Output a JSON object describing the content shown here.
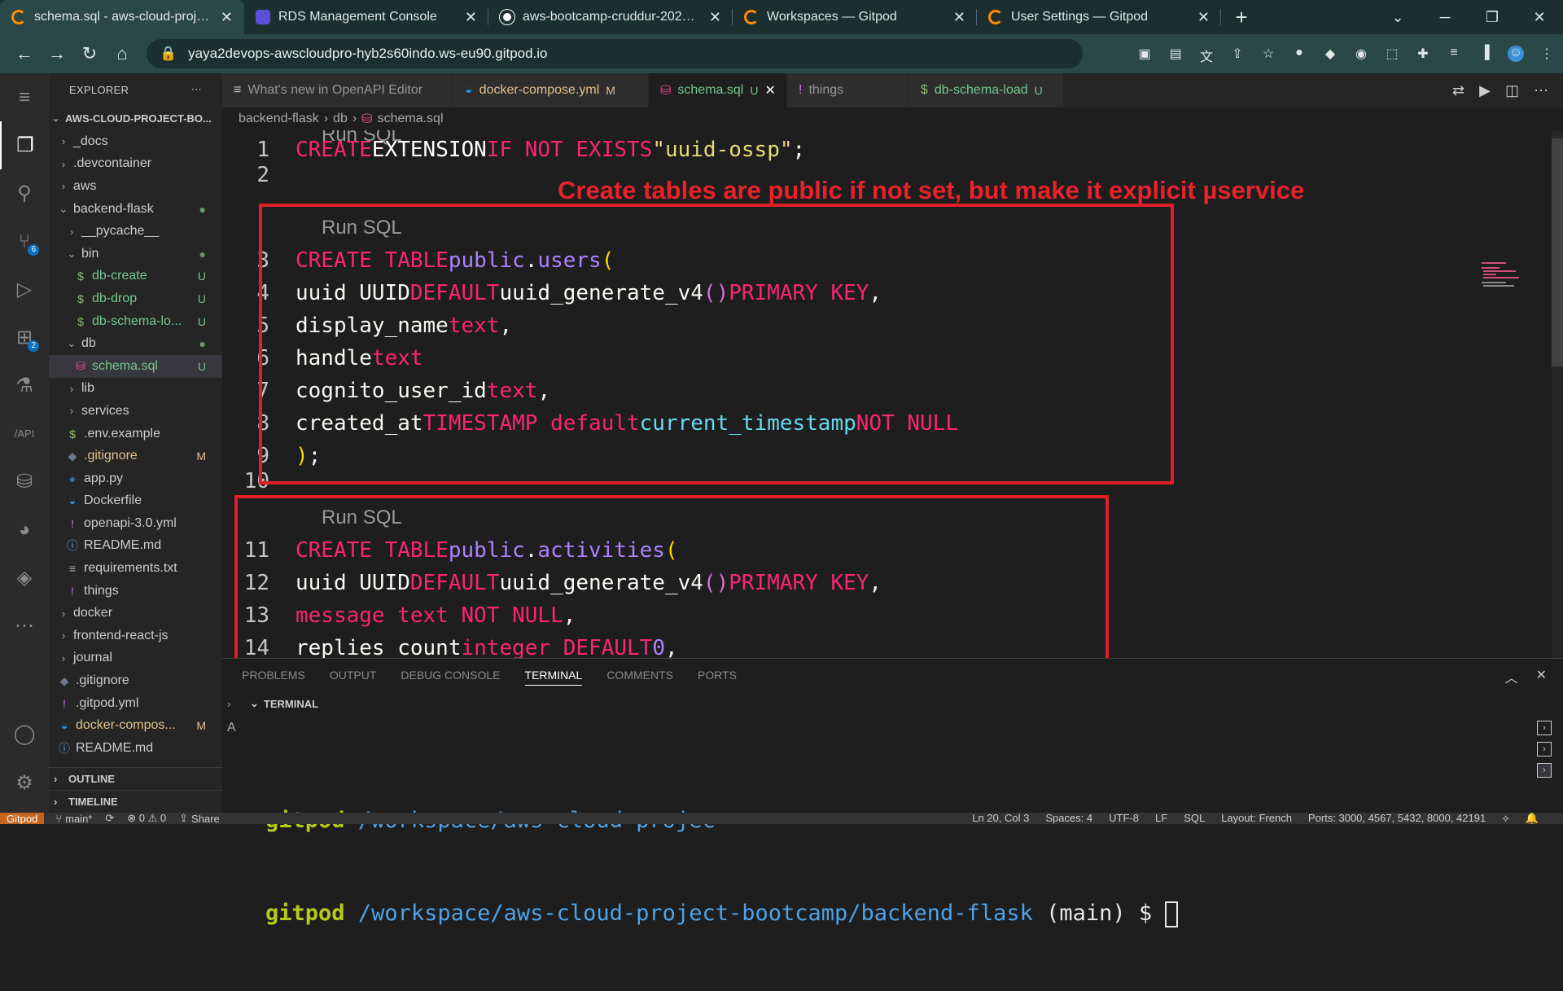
{
  "browser": {
    "tabs": [
      {
        "title": "schema.sql - aws-cloud-project-b",
        "icon": "gitpod-icon",
        "active": true
      },
      {
        "title": "RDS Management Console",
        "icon": "rds-icon",
        "active": false
      },
      {
        "title": "aws-bootcamp-cruddur-2023/we",
        "icon": "github-icon",
        "active": false
      },
      {
        "title": "Workspaces — Gitpod",
        "icon": "gitpod-icon",
        "active": false
      },
      {
        "title": "User Settings — Gitpod",
        "icon": "gitpod-icon",
        "active": false
      }
    ],
    "url": "yaya2devops-awscloudpro-hyb2s60indo.ws-eu90.gitpod.io"
  },
  "activity_badges": {
    "scm": "6",
    "extensions": "2"
  },
  "sidebar": {
    "title": "EXPLORER",
    "project": "AWS-CLOUD-PROJECT-BO...",
    "items": [
      {
        "label": "_docs",
        "indent": 1,
        "chevron": ">",
        "icon": "",
        "status": ""
      },
      {
        "label": ".devcontainer",
        "indent": 1,
        "chevron": ">",
        "icon": "",
        "status": ""
      },
      {
        "label": "aws",
        "indent": 1,
        "chevron": ">",
        "icon": "",
        "status": ""
      },
      {
        "label": "backend-flask",
        "indent": 1,
        "chevron": "v",
        "icon": "",
        "status": "●"
      },
      {
        "label": "__pycache__",
        "indent": 2,
        "chevron": ">",
        "icon": "",
        "status": ""
      },
      {
        "label": "bin",
        "indent": 2,
        "chevron": "v",
        "icon": "",
        "status": "●"
      },
      {
        "label": "db-create",
        "indent": 3,
        "chevron": "",
        "icon": "$",
        "status": "U"
      },
      {
        "label": "db-drop",
        "indent": 3,
        "chevron": "",
        "icon": "$",
        "status": "U"
      },
      {
        "label": "db-schema-lo...",
        "indent": 3,
        "chevron": "",
        "icon": "$",
        "status": "U"
      },
      {
        "label": "db",
        "indent": 2,
        "chevron": "v",
        "icon": "",
        "status": "●"
      },
      {
        "label": "schema.sql",
        "indent": 3,
        "chevron": "",
        "icon": "db",
        "status": "U",
        "selected": true
      },
      {
        "label": "lib",
        "indent": 2,
        "chevron": ">",
        "icon": "",
        "status": ""
      },
      {
        "label": "services",
        "indent": 2,
        "chevron": ">",
        "icon": "",
        "status": ""
      },
      {
        "label": ".env.example",
        "indent": 2,
        "chevron": "",
        "icon": "$",
        "status": ""
      },
      {
        "label": ".gitignore",
        "indent": 2,
        "chevron": "",
        "icon": "git",
        "status": "M"
      },
      {
        "label": "app.py",
        "indent": 2,
        "chevron": "",
        "icon": "py",
        "status": ""
      },
      {
        "label": "Dockerfile",
        "indent": 2,
        "chevron": "",
        "icon": "docker",
        "status": ""
      },
      {
        "label": "openapi-3.0.yml",
        "indent": 2,
        "chevron": "",
        "icon": "!",
        "status": ""
      },
      {
        "label": "README.md",
        "indent": 2,
        "chevron": "",
        "icon": "info",
        "status": ""
      },
      {
        "label": "requirements.txt",
        "indent": 2,
        "chevron": "",
        "icon": "txt",
        "status": ""
      },
      {
        "label": "things",
        "indent": 2,
        "chevron": "",
        "icon": "!",
        "status": ""
      },
      {
        "label": "docker",
        "indent": 1,
        "chevron": ">",
        "icon": "",
        "status": ""
      },
      {
        "label": "frontend-react-js",
        "indent": 1,
        "chevron": ">",
        "icon": "",
        "status": ""
      },
      {
        "label": "journal",
        "indent": 1,
        "chevron": ">",
        "icon": "",
        "status": ""
      },
      {
        "label": ".gitignore",
        "indent": 1,
        "chevron": "",
        "icon": "git",
        "status": ""
      },
      {
        "label": ".gitpod.yml",
        "indent": 1,
        "chevron": "",
        "icon": "!",
        "status": ""
      },
      {
        "label": "docker-compos...",
        "indent": 1,
        "chevron": "",
        "icon": "docker",
        "status": "M"
      },
      {
        "label": "README.md",
        "indent": 1,
        "chevron": "",
        "icon": "info",
        "status": ""
      }
    ],
    "outline": "OUTLINE",
    "timeline": "TIMELINE"
  },
  "editor_tabs": [
    {
      "label": "What's new in OpenAPI Editor",
      "icon": "≡",
      "mod": "",
      "active": false
    },
    {
      "label": "docker-compose.yml",
      "icon": "docker",
      "mod": "M",
      "active": false
    },
    {
      "label": "schema.sql",
      "icon": "db",
      "mod": "U",
      "active": true
    },
    {
      "label": "things",
      "icon": "!",
      "mod": "",
      "active": false
    },
    {
      "label": "db-schema-load",
      "icon": "$",
      "mod": "U",
      "active": false
    }
  ],
  "breadcrumb": [
    "backend-flask",
    "db",
    "schema.sql"
  ],
  "code": {
    "lens": "Run SQL",
    "annotation": "Create tables are public if not set, but make it explicit µservice"
  },
  "panel": {
    "tabs": [
      "PROBLEMS",
      "OUTPUT",
      "DEBUG CONSOLE",
      "TERMINAL",
      "COMMENTS",
      "PORTS"
    ],
    "active": "TERMINAL",
    "section": "TERMINAL",
    "lines": [
      {
        "user": "gitpod",
        "path": "/workspace/aws-cloud-projec",
        "rest": ""
      },
      {
        "user": "gitpod",
        "path": "/workspace/aws-cloud-project-bootcamp/backend-flask",
        "rest": " (main) $ "
      }
    ]
  },
  "statusbar": {
    "gitpod": "Gitpod",
    "branch": "main*",
    "problems": "⊗ 0 ⚠ 0",
    "share": "Share",
    "position": "Ln 20, Col 3",
    "spaces": "Spaces: 4",
    "encoding": "UTF-8",
    "eol": "LF",
    "lang": "SQL",
    "layout": "Layout: French",
    "ports": "Ports: 3000, 4567, 5432, 8000, 42191"
  }
}
